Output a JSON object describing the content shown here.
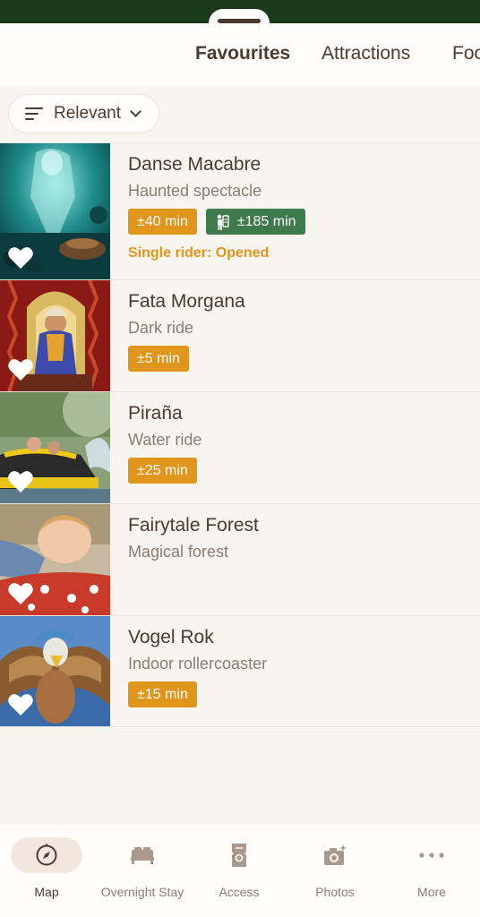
{
  "tabs": [
    {
      "label": "Favourites"
    },
    {
      "label": "Attractions"
    },
    {
      "label": "Foo"
    }
  ],
  "sort": {
    "label": "Relevant"
  },
  "attractions": [
    {
      "name": "Danse Macabre",
      "type": "Haunted spectacle",
      "wait": "±40 min",
      "fastpass": "±185 min",
      "single_rider": "Single rider: Opened"
    },
    {
      "name": "Fata Morgana",
      "type": "Dark ride",
      "wait": "±5 min"
    },
    {
      "name": "Piraña",
      "type": "Water ride",
      "wait": "±25 min"
    },
    {
      "name": "Fairytale Forest",
      "type": "Magical forest"
    },
    {
      "name": "Vogel Rok",
      "type": "Indoor rollercoaster",
      "wait": "±15 min"
    }
  ],
  "nav": [
    {
      "label": "Map",
      "icon": "compass-icon"
    },
    {
      "label": "Overnight Stay",
      "icon": "bed-icon"
    },
    {
      "label": "Access",
      "icon": "ticket-icon"
    },
    {
      "label": "Photos",
      "icon": "camera-icon"
    },
    {
      "label": "More",
      "icon": "more-icon"
    }
  ],
  "colors": {
    "header": "#1a3a1a",
    "background": "#f8f4ef",
    "wait_badge": "#e0951d",
    "fastpass_badge": "#3e7a4c",
    "text": "#4a3b30"
  }
}
